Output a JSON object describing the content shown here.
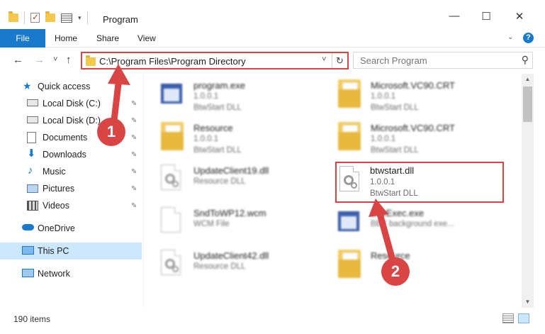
{
  "window": {
    "title": "Program",
    "controls": {
      "minimize": "—",
      "maximize": "☐",
      "close": "✕"
    }
  },
  "ribbon": {
    "tabs": [
      "File",
      "Home",
      "Share",
      "View"
    ],
    "expand_icon": "chevron-down-icon",
    "help_label": "?"
  },
  "nav": {
    "back": "←",
    "forward": "→",
    "recent": "˅",
    "up": "↑"
  },
  "address": {
    "path": "C:\\Program Files\\Program Directory",
    "dropdown": "˅",
    "refresh": "↻"
  },
  "search": {
    "placeholder": "Search Program",
    "icon": "🔍"
  },
  "sidebar": {
    "items": [
      {
        "label": "Quick access",
        "icon": "star-icon",
        "pinned": false
      },
      {
        "label": "Local Disk (C:)",
        "icon": "drive-icon",
        "pinned": true
      },
      {
        "label": "Local Disk (D:)",
        "icon": "drive-icon",
        "pinned": true
      },
      {
        "label": "Documents",
        "icon": "documents-icon",
        "pinned": true
      },
      {
        "label": "Downloads",
        "icon": "download-icon",
        "pinned": true
      },
      {
        "label": "Music",
        "icon": "music-icon",
        "pinned": true
      },
      {
        "label": "Pictures",
        "icon": "pictures-icon",
        "pinned": true
      },
      {
        "label": "Videos",
        "icon": "videos-icon",
        "pinned": true
      },
      {
        "label": "OneDrive",
        "icon": "cloud-icon",
        "pinned": false
      },
      {
        "label": "This PC",
        "icon": "computer-icon",
        "pinned": false,
        "selected": true
      },
      {
        "label": "Network",
        "icon": "network-icon",
        "pinned": false
      }
    ],
    "pin_glyph": "📌"
  },
  "files": [
    {
      "name": "program.exe",
      "version": "1.0.0.1",
      "desc": "BtwStart DLL",
      "icon": "exe-icon",
      "blurred": true
    },
    {
      "name": "Microsoft.VC90.CRT",
      "version": "1.0.0.1",
      "desc": "BtwStart DLL",
      "icon": "folder-icon",
      "blurred": true
    },
    {
      "name": "Resource",
      "version": "1.0.0.1",
      "desc": "BtwStart DLL",
      "icon": "folder-icon",
      "blurred": true
    },
    {
      "name": "Microsoft.VC90.CRT",
      "version": "1.0.0.1",
      "desc": "BtwStart DLL",
      "icon": "folder-icon",
      "blurred": true
    },
    {
      "name": "UpdateClient19.dll",
      "version": "",
      "desc": "Resource DLL",
      "icon": "dll-icon",
      "blurred": true
    },
    {
      "name": "btwstart.dll",
      "version": "1.0.0.1",
      "desc": "BtwStart DLL",
      "icon": "dll-icon",
      "blurred": false
    },
    {
      "name": "SndToWP12.wcm",
      "version": "",
      "desc": "WCM File",
      "icon": "document-icon",
      "blurred": true
    },
    {
      "name": "BtwExec.exe",
      "version": "",
      "desc": "BBY background exe...",
      "icon": "exe-icon",
      "blurred": true
    },
    {
      "name": "UpdateClient42.dll",
      "version": "",
      "desc": "Resource DLL",
      "icon": "dll-icon",
      "blurred": true
    },
    {
      "name": "Resource",
      "version": "",
      "desc": "",
      "icon": "folder-icon",
      "blurred": true
    }
  ],
  "callouts": [
    "1",
    "2"
  ],
  "status": {
    "count": "190 items"
  },
  "colors": {
    "accent": "#1979ca",
    "highlight": "#d94545",
    "selected": "#cce8ff"
  }
}
